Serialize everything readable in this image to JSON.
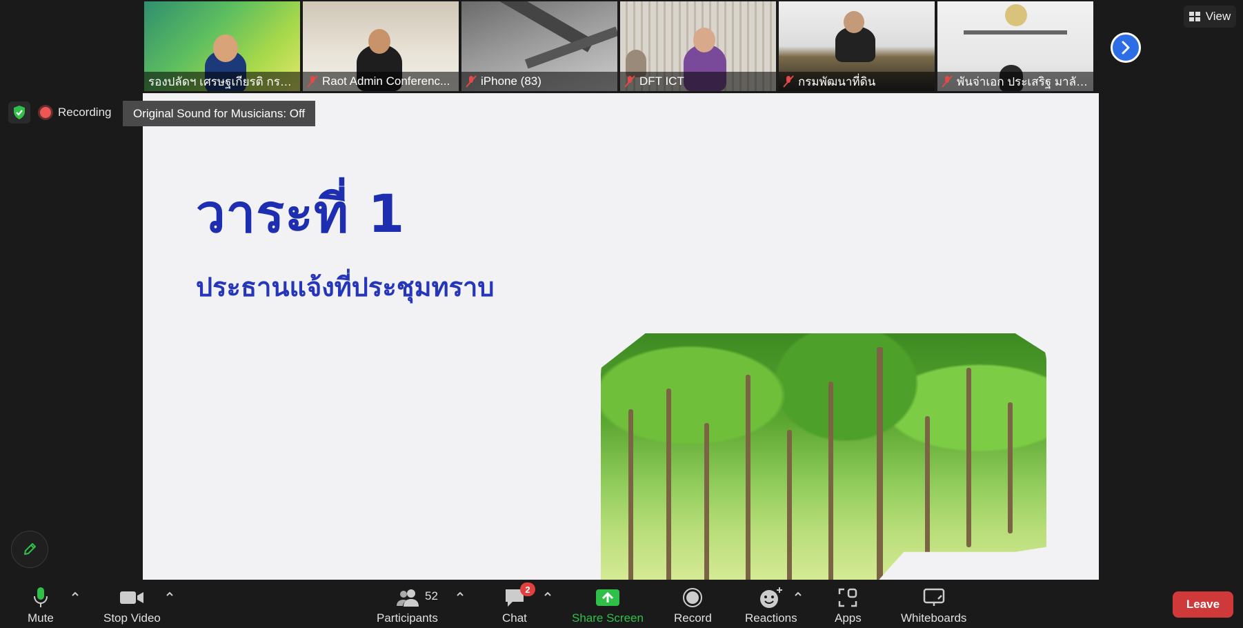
{
  "participants_strip": [
    {
      "name": "รองปลัดฯ เศรษฐเกียรติ กระจ่าง...",
      "muted": false,
      "active": true
    },
    {
      "name": "Raot Admin Conferenc...",
      "muted": true,
      "active": false
    },
    {
      "name": "iPhone (83)",
      "muted": true,
      "active": false
    },
    {
      "name": "DFT ICT",
      "muted": true,
      "active": false
    },
    {
      "name": "กรมพัฒนาที่ดิน",
      "muted": true,
      "active": false
    },
    {
      "name": "พันจ่าเอก ประเสริฐ มาลัย ...",
      "muted": true,
      "active": false
    }
  ],
  "view_button": {
    "label": "View"
  },
  "recording": {
    "label": "Recording"
  },
  "tooltip": {
    "text": "Original Sound for Musicians: Off"
  },
  "slide": {
    "title": "วาระที่ 1",
    "subtitle": "ประธานแจ้งที่ประชุมทราบ"
  },
  "toolbar": {
    "mute": "Mute",
    "stop_video": "Stop Video",
    "participants": "Participants",
    "participants_count": "52",
    "chat": "Chat",
    "chat_badge": "2",
    "share_screen": "Share Screen",
    "record": "Record",
    "reactions": "Reactions",
    "apps": "Apps",
    "whiteboards": "Whiteboards",
    "leave": "Leave"
  },
  "colors": {
    "accent_green": "#30c04a",
    "leave_red": "#d0393a",
    "slide_title_blue": "#1d2fb0",
    "next_blue": "#2d6ee6"
  }
}
